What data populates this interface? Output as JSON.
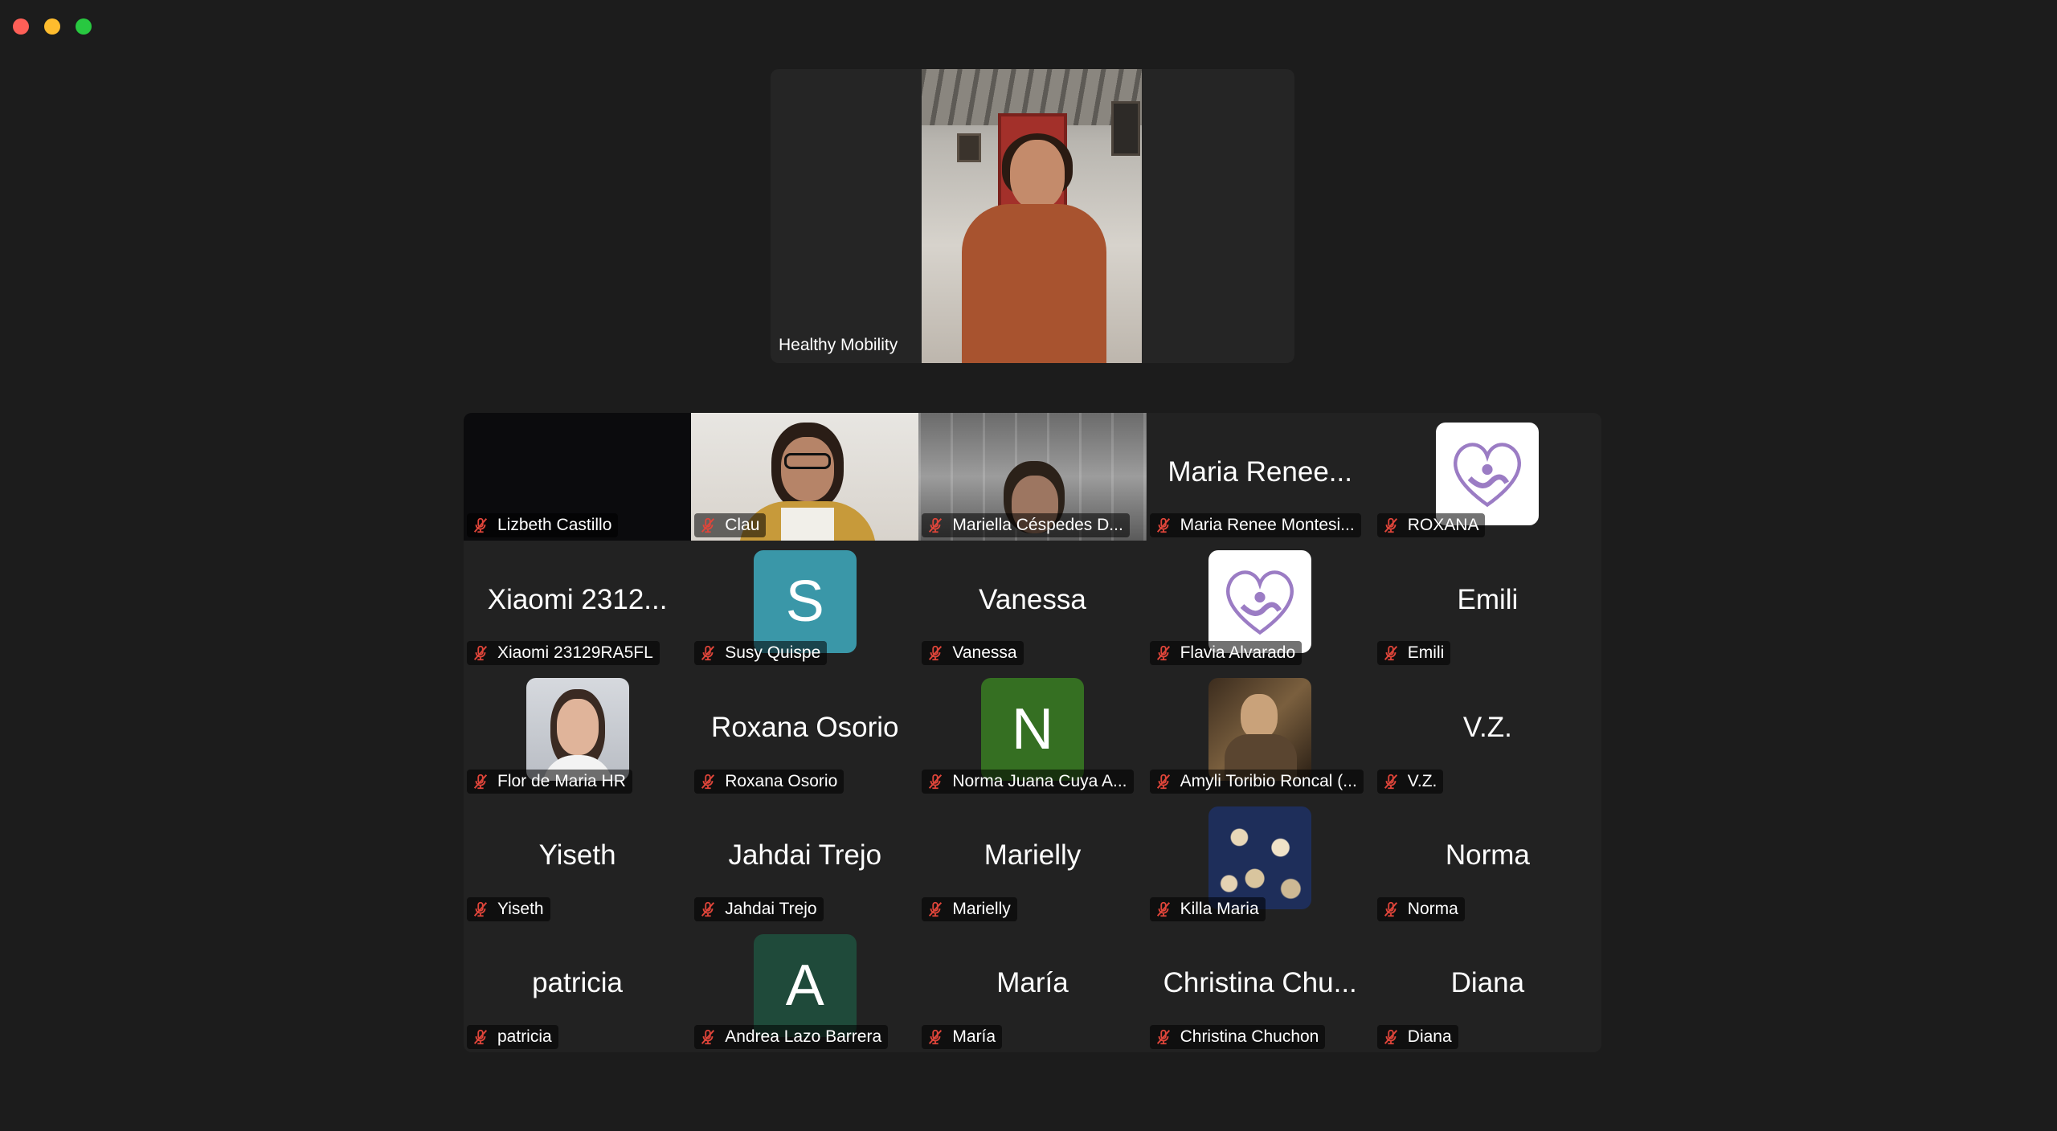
{
  "speaker": {
    "name": "Healthy Mobility"
  },
  "participants": [
    {
      "name": "Lizbeth Castillo",
      "tile_text": "",
      "kind": "black"
    },
    {
      "name": "Clau",
      "tile_text": "",
      "kind": "video-clau"
    },
    {
      "name": "Mariella Céspedes D...",
      "tile_text": "",
      "kind": "video-mariella"
    },
    {
      "name": "Maria Renee Montesi...",
      "tile_text": "Maria Renee...",
      "kind": "text"
    },
    {
      "name": "ROXANA",
      "tile_text": "",
      "kind": "heart-logo"
    },
    {
      "name": "Xiaomi 23129RA5FL",
      "tile_text": "Xiaomi 2312...",
      "kind": "text"
    },
    {
      "name": "Susy Quispe",
      "tile_text": "S",
      "kind": "letter",
      "color": "#3a97a8"
    },
    {
      "name": "Vanessa",
      "tile_text": "Vanessa",
      "kind": "text"
    },
    {
      "name": "Flavia Alvarado",
      "tile_text": "",
      "kind": "heart-logo"
    },
    {
      "name": "Emili",
      "tile_text": "Emili",
      "kind": "text"
    },
    {
      "name": "Flor de Maria HR",
      "tile_text": "",
      "kind": "photo-flor"
    },
    {
      "name": "Roxana Osorio",
      "tile_text": "Roxana Osorio",
      "kind": "text"
    },
    {
      "name": "Norma Juana Cuya A...",
      "tile_text": "N",
      "kind": "letter",
      "color": "#356f22"
    },
    {
      "name": "Amyli Toribio Roncal (...",
      "tile_text": "",
      "kind": "photo-amyli"
    },
    {
      "name": "V.Z.",
      "tile_text": "V.Z.",
      "kind": "text"
    },
    {
      "name": "Yiseth",
      "tile_text": "Yiseth",
      "kind": "text"
    },
    {
      "name": "Jahdai Trejo",
      "tile_text": "Jahdai Trejo",
      "kind": "text"
    },
    {
      "name": "Marielly",
      "tile_text": "Marielly",
      "kind": "text"
    },
    {
      "name": "Killa Maria",
      "tile_text": "",
      "kind": "photo-killa"
    },
    {
      "name": "Norma",
      "tile_text": "Norma",
      "kind": "text"
    },
    {
      "name": "patricia",
      "tile_text": "patricia",
      "kind": "text"
    },
    {
      "name": "Andrea Lazo Barrera",
      "tile_text": "A",
      "kind": "letter",
      "color": "#1f4a3a"
    },
    {
      "name": "María",
      "tile_text": "María",
      "kind": "text"
    },
    {
      "name": "Christina Chuchon",
      "tile_text": "Christina Chu...",
      "kind": "text"
    },
    {
      "name": "Diana",
      "tile_text": "Diana",
      "kind": "text"
    }
  ],
  "colors": {
    "window_bg": "#1c1c1c",
    "tile_bg": "#222222",
    "muted_mic": "#e0453a"
  }
}
